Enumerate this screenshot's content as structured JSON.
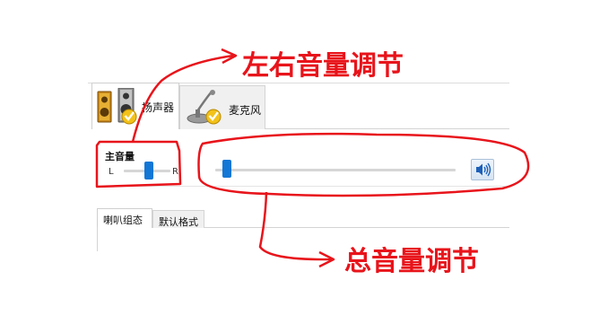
{
  "device_tabs": [
    {
      "label": "扬声器",
      "icon": "speaker-icon",
      "selected": true
    },
    {
      "label": "麦克风",
      "icon": "microphone-icon",
      "selected": false
    }
  ],
  "balance": {
    "title": "主音量",
    "left_label": "L",
    "right_label": "R",
    "position": 0.55
  },
  "master_volume": {
    "level": 0.03,
    "button_icon": "speaker-volume-icon"
  },
  "sub_tabs": [
    {
      "label": "喇叭组态",
      "selected": true
    },
    {
      "label": "默认格式",
      "selected": false
    }
  ],
  "annotations": {
    "top": "左右音量调节",
    "bottom": "总音量调节",
    "color": "#e8141b"
  },
  "colors": {
    "thumb": "#1377d6"
  }
}
